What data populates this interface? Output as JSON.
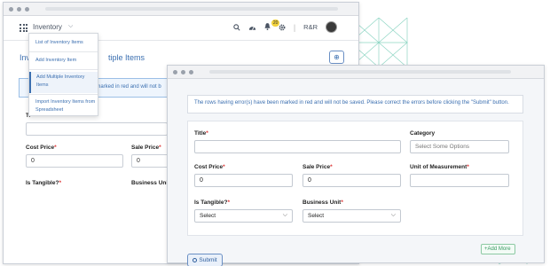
{
  "back": {
    "module_title": "Inventory",
    "badge_count": "20",
    "company": "R&R",
    "heading_left": "Inv",
    "heading_right": "tiple Items",
    "alert_text": "en marked in red and will not b",
    "title_label_fragment": "Ti",
    "labels": {
      "cost_price": "Cost Price",
      "sale_price": "Sale Price",
      "is_tangible": "Is Tangible?",
      "business_unit": "Business Unit"
    },
    "values": {
      "cost_price": "0",
      "sale_price": "0"
    }
  },
  "menu": {
    "items": [
      {
        "label": "List of Inventory Items",
        "active": false
      },
      {
        "label": "Add Inventory Item",
        "active": false
      },
      {
        "label": "Add Multiple Inventory Items",
        "active": true
      },
      {
        "label": "Import Inventory Items from Spreadsheet",
        "active": false
      }
    ]
  },
  "front": {
    "alert_text": "The rows having error(s) have been marked in red and will not be saved. Please correct the errors before clicking the \"Submit\" button.",
    "fields": {
      "title_label": "Title",
      "category_label": "Category",
      "category_placeholder": "Select Some Options",
      "cost_price_label": "Cost Price",
      "cost_price_value": "0",
      "sale_price_label": "Sale Price",
      "sale_price_value": "0",
      "uom_label": "Unit of Measurement",
      "is_tangible_label": "Is Tangible?",
      "is_tangible_value": "Select",
      "business_unit_label": "Business Unit",
      "business_unit_value": "Select"
    },
    "required_mark": "*",
    "add_more_label": "Add More",
    "submit_label": "Submit"
  },
  "colors": {
    "accent": "#3b6fb0",
    "pattern": "#8fd6c4",
    "add_more": "#3a9a63"
  },
  "icons": [
    "grid-icon",
    "chevron-down-icon",
    "search-icon",
    "dashboard-icon",
    "bell-icon",
    "gear-icon",
    "avatar",
    "plus-circle-icon",
    "plus-icon",
    "check-circle-icon"
  ]
}
